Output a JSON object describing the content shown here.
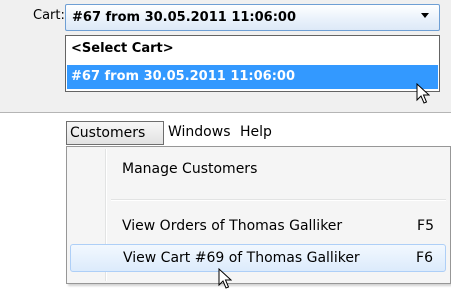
{
  "cart": {
    "label": "Cart:",
    "selected_value": "#67 from 30.05.2011 11:06:00",
    "options": [
      "<Select Cart>",
      "#67 from 30.05.2011 11:06:00"
    ],
    "highlighted_index": 1
  },
  "menubar": {
    "items": [
      "Customers",
      "Windows",
      "Help"
    ],
    "active": "Customers"
  },
  "customers_menu": {
    "items": [
      {
        "label": "Manage Customers",
        "shortcut": ""
      },
      {
        "label": "View Orders of Thomas Galliker",
        "shortcut": "F5"
      },
      {
        "label": "View Cart #69 of Thomas Galliker",
        "shortcut": "F6"
      }
    ],
    "hovered_index": 2
  },
  "colors": {
    "selection": "#3399ff",
    "hover": "#dcebfc"
  },
  "icons": [
    "mouse-pointer-icon",
    "mouse-pointer-icon",
    "dropdown-arrow-icon"
  ]
}
